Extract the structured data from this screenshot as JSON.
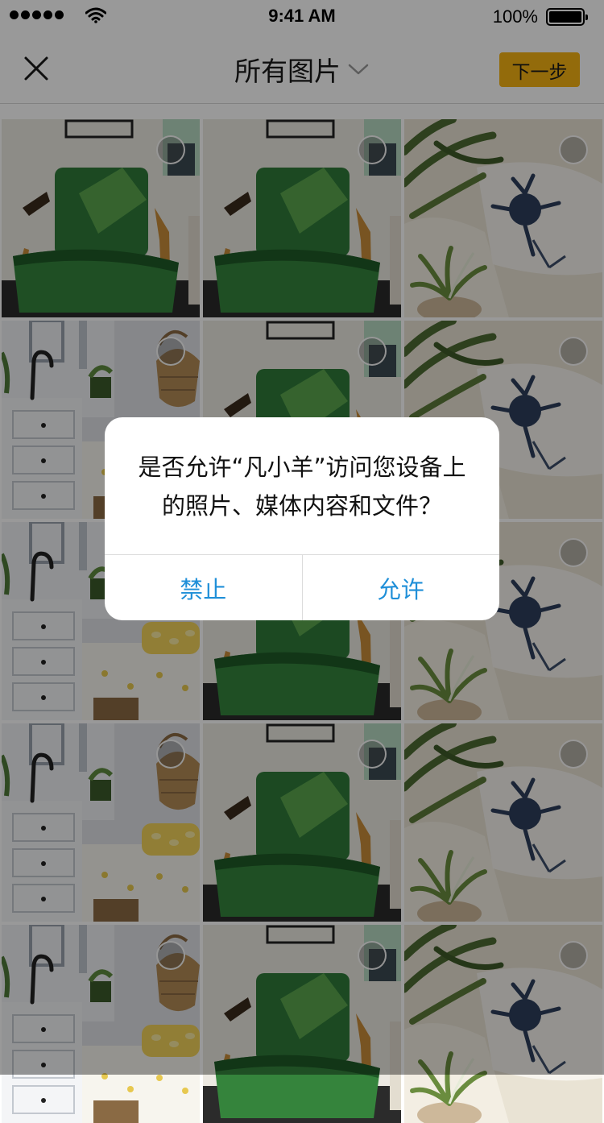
{
  "status_bar": {
    "time": "9:41 AM",
    "battery_percent": "100%",
    "signal_bars": 5,
    "signal_icon": "signal-dots-icon",
    "wifi_icon": "wifi-icon",
    "battery_icon": "battery-full-icon"
  },
  "nav": {
    "close_icon": "close-icon",
    "title": "所有图片",
    "title_chevron_icon": "chevron-down-icon",
    "next_label": "下一步"
  },
  "colors": {
    "accent": "#f6b213",
    "alert_action": "#1f8fd8",
    "overlay": "rgba(0,0,0,0.40)"
  },
  "grid": {
    "columns": 3,
    "tiles": [
      {
        "photo": "green-chair"
      },
      {
        "photo": "green-chair"
      },
      {
        "photo": "sofa-plant"
      },
      {
        "photo": "kitchen-basket"
      },
      {
        "photo": "green-chair"
      },
      {
        "photo": "sofa-plant"
      },
      {
        "photo": "kitchen-basket"
      },
      {
        "photo": "green-chair"
      },
      {
        "photo": "sofa-plant"
      },
      {
        "photo": "kitchen-basket"
      },
      {
        "photo": "green-chair"
      },
      {
        "photo": "sofa-plant"
      },
      {
        "photo": "kitchen-basket"
      },
      {
        "photo": "green-chair"
      },
      {
        "photo": "sofa-plant"
      }
    ]
  },
  "alert": {
    "message_line1": "是否允许“凡小羊”访问您设备上",
    "message_line2": "的照片、媒体内容和文件？",
    "deny_label": "禁止",
    "allow_label": "允许"
  }
}
